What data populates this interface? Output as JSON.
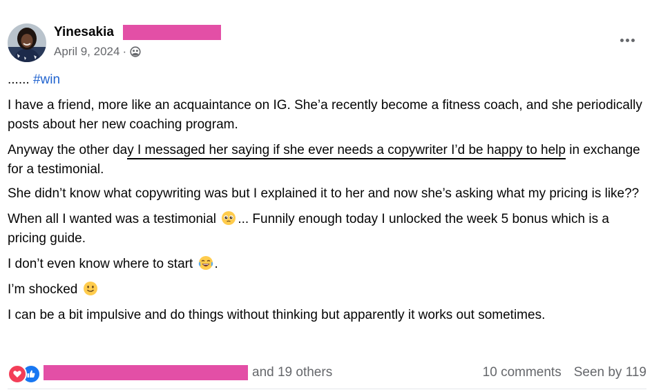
{
  "post": {
    "author": "Yinesakia",
    "date": "April 9, 2024",
    "separator": "·",
    "audience_icon": "friends-icon",
    "more_icon": "more-icon",
    "dots": "......",
    "hashtag": "#win",
    "paragraphs": {
      "p1": "I have a friend, more like an acquaintance on IG. She’a recently become a fitness coach, and she periodically posts about her new coaching program.",
      "p2_start": "Anyway the other da",
      "p2_underlined": "y I messaged her saying if she ever needs a copywriter I’d be happy to help",
      "p2_end": " in exchange for a testimonial.",
      "p3": "She didn’t know what copywriting was but I explained it to her and now she’s asking what my pricing is like??",
      "p4_start": "When all I wanted was a testimonial ",
      "p4_end": "... Funnily enough today I unlocked the week 5 bonus which is a pricing guide.",
      "p5_start": "I don’t even know where to start ",
      "p5_end": ".",
      "p6_start": "I’m shocked ",
      "p7": "I can be a bit impulsive and do things without thinking but apparently it works out sometimes."
    },
    "emojis": [
      "pleading-face-emoji",
      "joy-emoji",
      "slight-smile-emoji"
    ]
  },
  "footer": {
    "reaction_icons": [
      "love-reaction-icon",
      "like-reaction-icon"
    ],
    "others_text": "and 19 others",
    "comments_text": "10 comments",
    "seen_text": "Seen by 119"
  },
  "colors": {
    "redaction": "#e34fa6",
    "hashtag": "#2063cf",
    "secondary_text": "#65676b",
    "love": "#f33e58",
    "like": "#1877f2"
  }
}
